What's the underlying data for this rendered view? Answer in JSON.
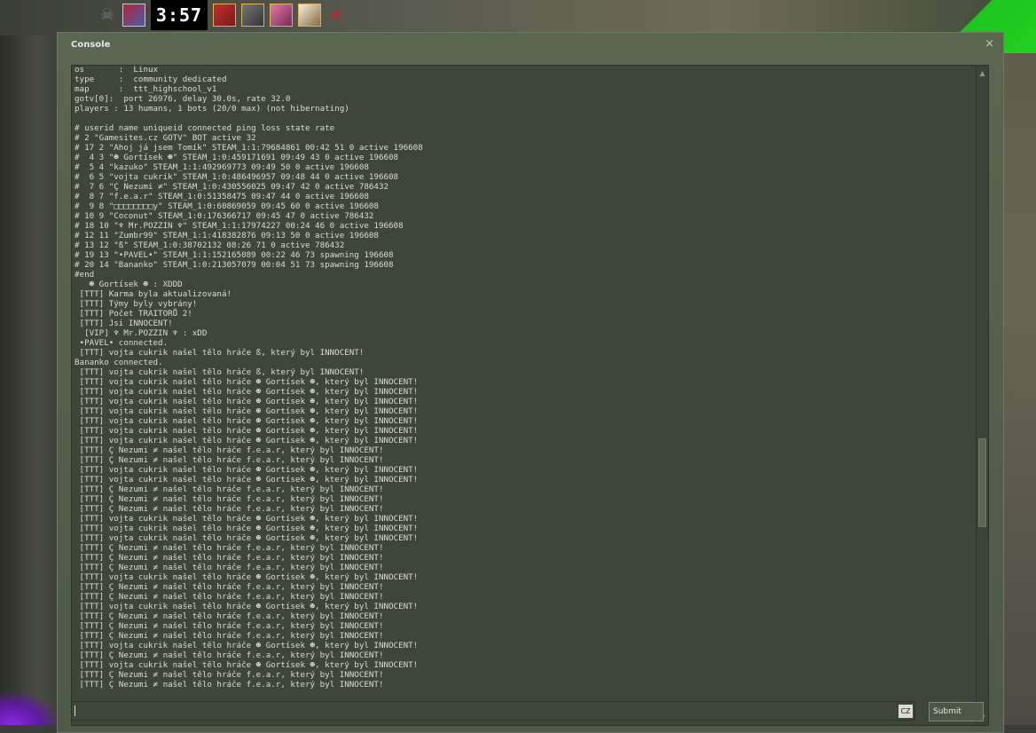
{
  "hud": {
    "timer": "3:57"
  },
  "window": {
    "title": "Console",
    "close_label": "×"
  },
  "log": {
    "lines": [
      "os       :  Linux",
      "type     :  community dedicated",
      "map      :  ttt_highschool_v1",
      "gotv[0]:  port 26976, delay 30.0s, rate 32.0",
      "players : 13 humans, 1 bots (20/0 max) (not hibernating)",
      "",
      "# userid name uniqueid connected ping loss state rate",
      "# 2 \"Gamesites.cz GOTV\" BOT active 32",
      "# 17 2 \"Ahoj já jsem Tomík\" STEAM_1:1:79684861 00:42 51 0 active 196608",
      "#  4 3 \"☻ Gortísek ☻\" STEAM_1:0:459171691 09:49 43 0 active 196608",
      "#  5 4 \"kazuko\" STEAM_1:1:492969773 09:49 50 0 active 196608",
      "#  6 5 \"vojta cukrik\" STEAM_1:0:486496957 09:48 44 0 active 196608",
      "#  7 6 \"Ç Nezumi ≠\" STEAM_1:0:430556025 09:47 42 0 active 786432",
      "#  8 7 \"f.e.a.r\" STEAM_1:0:51358475 09:47 44 0 active 196608",
      "#  9 8 \"□□□□□□□□y\" STEAM_1:0:60869059 09:45 60 0 active 196608",
      "# 10 9 \"Coconut\" STEAM_1:0:176366717 09:45 47 0 active 786432",
      "# 18 10 \"♆ Mr.POZZIN ♆\" STEAM_1:1:17974227 00:24 46 0 active 196608",
      "# 12 11 \"Zumbr99\" STEAM_1:1:418382876 09:13 50 0 active 196608",
      "# 13 12 \"ß\" STEAM_1:0:38702132 08:26 71 0 active 786432",
      "# 19 13 \"•PAVEL•\" STEAM_1:1:152165089 00:22 46 73 spawning 196608",
      "# 20 14 \"Bananko\" STEAM_1:0:213057079 00:04 51 73 spawning 196608",
      "#end",
      "   ☻ Gortísek ☻ : XDDD",
      " [TTT] Karma byla aktualizovaná!",
      " [TTT] Týmy byly vybrány!",
      " [TTT] Počet TRAITORŮ 2!",
      " [TTT] Jsi INNOCENT!",
      "  [VIP] ♆ Mr.POZZIN ♆ : xDD",
      " •PAVEL• connected.",
      " [TTT] vojta cukrik našel tělo hráče ß, který byl INNOCENT!",
      "Bananko connected.",
      " [TTT] vojta cukrik našel tělo hráče ß, který byl INNOCENT!",
      " [TTT] vojta cukrik našel tělo hráče ☻ Gortísek ☻, který byl INNOCENT!",
      " [TTT] vojta cukrik našel tělo hráče ☻ Gortísek ☻, který byl INNOCENT!",
      " [TTT] vojta cukrik našel tělo hráče ☻ Gortísek ☻, který byl INNOCENT!",
      " [TTT] vojta cukrik našel tělo hráče ☻ Gortísek ☻, který byl INNOCENT!",
      " [TTT] vojta cukrik našel tělo hráče ☻ Gortísek ☻, který byl INNOCENT!",
      " [TTT] vojta cukrik našel tělo hráče ☻ Gortísek ☻, který byl INNOCENT!",
      " [TTT] vojta cukrik našel tělo hráče ☻ Gortísek ☻, který byl INNOCENT!",
      " [TTT] Ç Nezumi ≠ našel tělo hráče f.e.a.r, který byl INNOCENT!",
      " [TTT] Ç Nezumi ≠ našel tělo hráče f.e.a.r, který byl INNOCENT!",
      " [TTT] vojta cukrik našel tělo hráče ☻ Gortísek ☻, který byl INNOCENT!",
      " [TTT] vojta cukrik našel tělo hráče ☻ Gortísek ☻, který byl INNOCENT!",
      " [TTT] Ç Nezumi ≠ našel tělo hráče f.e.a.r, který byl INNOCENT!",
      " [TTT] Ç Nezumi ≠ našel tělo hráče f.e.a.r, který byl INNOCENT!",
      " [TTT] Ç Nezumi ≠ našel tělo hráče f.e.a.r, který byl INNOCENT!",
      " [TTT] vojta cukrik našel tělo hráče ☻ Gortísek ☻, který byl INNOCENT!",
      " [TTT] vojta cukrik našel tělo hráče ☻ Gortísek ☻, který byl INNOCENT!",
      " [TTT] vojta cukrik našel tělo hráče ☻ Gortísek ☻, který byl INNOCENT!",
      " [TTT] Ç Nezumi ≠ našel tělo hráče f.e.a.r, který byl INNOCENT!",
      " [TTT] Ç Nezumi ≠ našel tělo hráče f.e.a.r, který byl INNOCENT!",
      " [TTT] Ç Nezumi ≠ našel tělo hráče f.e.a.r, který byl INNOCENT!",
      " [TTT] vojta cukrik našel tělo hráče ☻ Gortísek ☻, který byl INNOCENT!",
      " [TTT] Ç Nezumi ≠ našel tělo hráče f.e.a.r, který byl INNOCENT!",
      " [TTT] Ç Nezumi ≠ našel tělo hráče f.e.a.r, který byl INNOCENT!",
      " [TTT] vojta cukrik našel tělo hráče ☻ Gortísek ☻, který byl INNOCENT!",
      " [TTT] Ç Nezumi ≠ našel tělo hráče f.e.a.r, který byl INNOCENT!",
      " [TTT] Ç Nezumi ≠ našel tělo hráče f.e.a.r, který byl INNOCENT!",
      " [TTT] Ç Nezumi ≠ našel tělo hráče f.e.a.r, který byl INNOCENT!",
      " [TTT] vojta cukrik našel tělo hráče ☻ Gortísek ☻, který byl INNOCENT!",
      " [TTT] Ç Nezumi ≠ našel tělo hráče f.e.a.r, který byl INNOCENT!",
      " [TTT] vojta cukrik našel tělo hráče ☻ Gortísek ☻, který byl INNOCENT!",
      " [TTT] Ç Nezumi ≠ našel tělo hráče f.e.a.r, který byl INNOCENT!",
      " [TTT] Ç Nezumi ≠ našel tělo hráče f.e.a.r, který byl INNOCENT!"
    ]
  },
  "input": {
    "value": "",
    "lang_indicator": "CZ"
  },
  "submit_label": "Submit"
}
